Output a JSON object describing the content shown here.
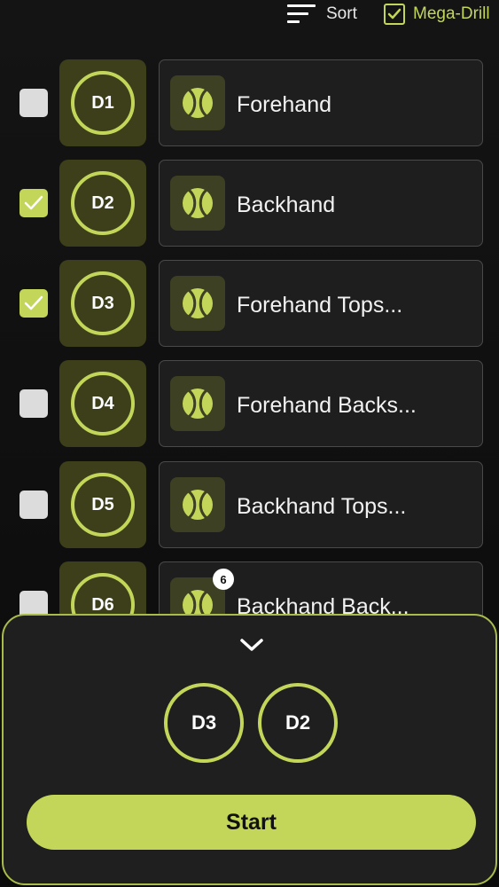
{
  "toolbar": {
    "sort_label": "Sort",
    "sort_icon": "sort-lines-icon",
    "mega_drill_label": "Mega-Drill",
    "mega_drill_checked": true
  },
  "drills": [
    {
      "code": "D1",
      "name": "Forehand",
      "checked": false
    },
    {
      "code": "D2",
      "name": "Backhand",
      "checked": true
    },
    {
      "code": "D3",
      "name": "Forehand Tops...",
      "checked": true
    },
    {
      "code": "D4",
      "name": "Forehand Backs...",
      "checked": false
    },
    {
      "code": "D5",
      "name": "Backhand Tops...",
      "checked": false
    },
    {
      "code": "D6",
      "name": "Backhand Back...",
      "checked": false,
      "badge": "6"
    }
  ],
  "selection": {
    "collapse_icon": "chevron-down-icon",
    "selected": [
      "D3",
      "D2"
    ],
    "start_label": "Start"
  },
  "colors": {
    "accent": "#c3d65a",
    "background": "#0a0a0a",
    "card": "#1e1e1e"
  }
}
